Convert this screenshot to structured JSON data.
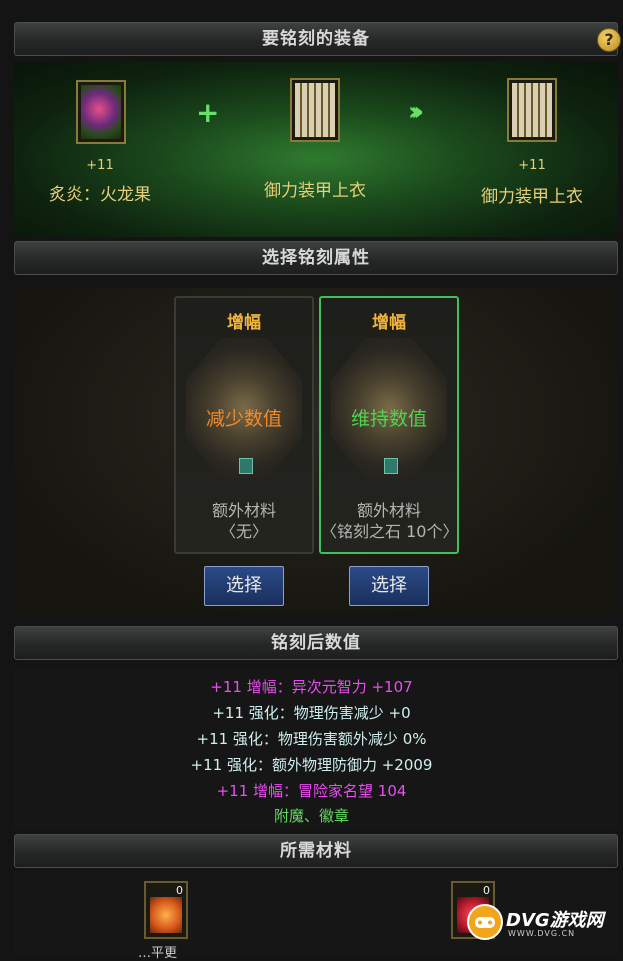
{
  "sections": {
    "equipment": "要铭刻的装备",
    "attribute": "选择铭刻属性",
    "result": "铭刻后数值",
    "materials": "所需材料"
  },
  "help": {
    "label": "?"
  },
  "equipment": {
    "source": {
      "level": "+11",
      "name": "炙炎：火龙果"
    },
    "target": {
      "level": "",
      "name": "御力装甲上衣"
    },
    "output": {
      "level": "+11",
      "name": "御力装甲上衣"
    },
    "plus_symbol": "+",
    "arrow_symbol": "›››"
  },
  "options": [
    {
      "title": "增幅",
      "value": "减少数值",
      "value_color": "#f28a2a",
      "extra_label": "额外材料",
      "extra_detail": "〈无〉",
      "button": "选择",
      "selected": false
    },
    {
      "title": "增幅",
      "value": "维持数值",
      "value_color": "#4fd44f",
      "extra_label": "额外材料",
      "extra_detail": "〈铭刻之石 10个〉",
      "button": "选择",
      "selected": true
    }
  ],
  "result_lines": [
    {
      "text": "+11  增幅：异次元智力 +107",
      "color": "#e84ef0"
    },
    {
      "text": "+11  强化：物理伤害减少 +0",
      "color": "#cfeeee"
    },
    {
      "text": "+11  强化：物理伤害额外减少 0%",
      "color": "#cfeeee"
    },
    {
      "text": "+11  强化：额外物理防御力 +2009",
      "color": "#cfeeee"
    },
    {
      "text": "+11  增幅：冒险家名望 104",
      "color": "#e84ef0"
    },
    {
      "text": "附魔、徽章",
      "color": "#62d862"
    }
  ],
  "materials": [
    {
      "count": "0",
      "name": "…平更",
      "icon": "orange-crystal-icon"
    },
    {
      "count": "0",
      "name": "",
      "icon": "red-scroll-icon"
    }
  ],
  "watermark": {
    "brand": "DVG游戏网",
    "url": "WWW.DVG.CN"
  }
}
